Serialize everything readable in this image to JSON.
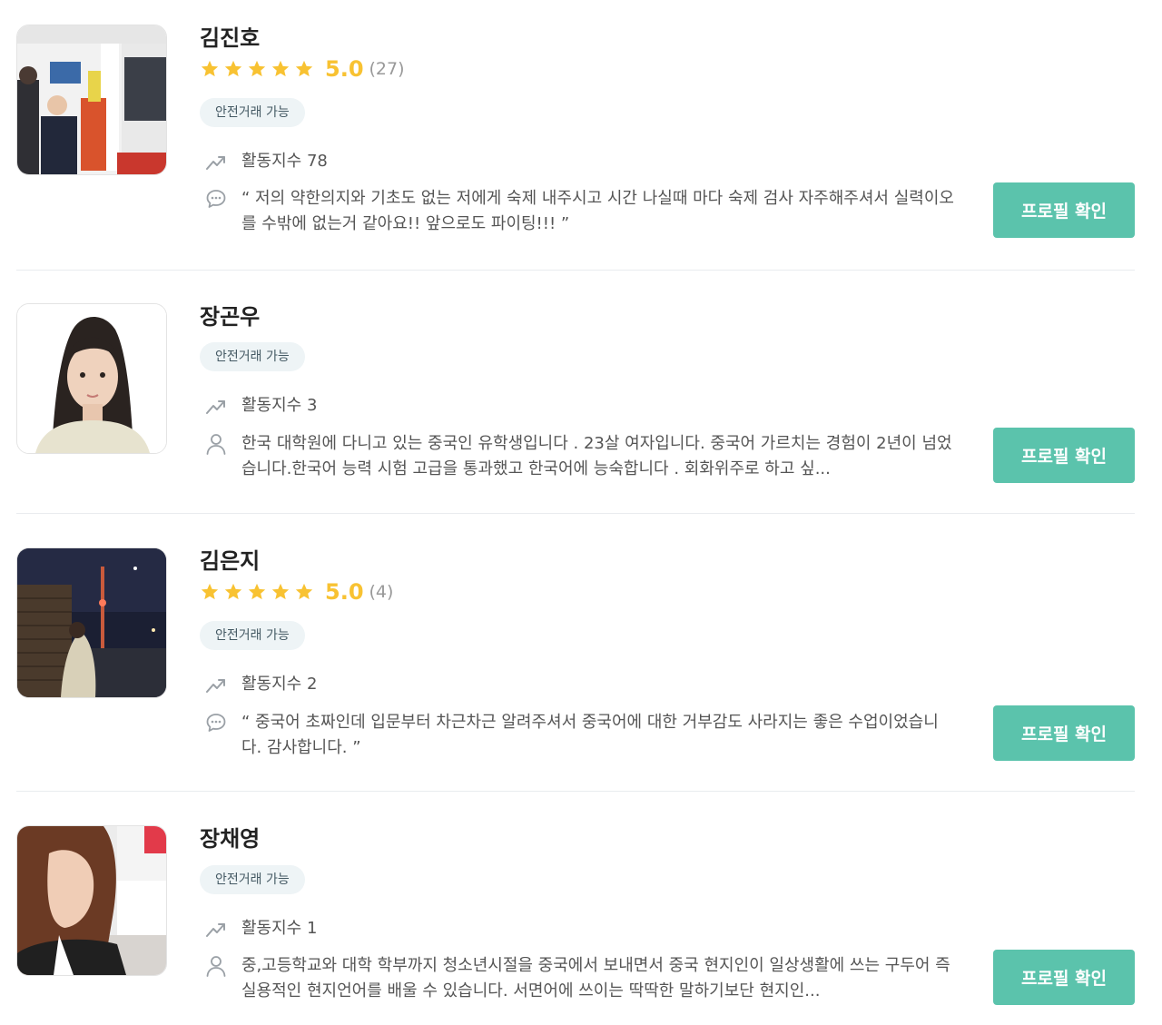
{
  "tutors": [
    {
      "name": "김진호",
      "has_rating": true,
      "rating": "5.0",
      "review_count": "(27)",
      "badge": "안전거래 가능",
      "activity": "활동지수 78",
      "desc_type": "review",
      "desc_icon": "speech-bubble-icon",
      "description": "“ 저의 약한의지와 기초도 없는 저에게 숙제 내주시고 시간 나실때 마다 숙제 검사 자주해주셔서 실력이오를 수밖에 없는거 같아요!! 앞으로도 파이팅!!! ”",
      "button": "프로필 확인"
    },
    {
      "name": "장곤우",
      "has_rating": false,
      "badge": "안전거래 가능",
      "activity": "활동지수 3",
      "desc_type": "intro",
      "desc_icon": "person-icon",
      "description": "한국 대학원에 다니고 있는 중국인 유학생입니다 . 23살 여자입니다. 중국어 가르치는 경험이 2년이 넘었습니다.한국어 능력 시험 고급을 통과했고 한국어에 능숙합니다 . 회화위주로 하고 싶...",
      "button": "프로필 확인"
    },
    {
      "name": "김은지",
      "has_rating": true,
      "rating": "5.0",
      "review_count": "(4)",
      "badge": "안전거래 가능",
      "activity": "활동지수 2",
      "desc_type": "review",
      "desc_icon": "speech-bubble-icon",
      "description": "“ 중국어 초짜인데 입문부터 차근차근 알려주셔서 중국어에 대한 거부감도 사라지는 좋은 수업이었습니다. 감사합니다. ”",
      "button": "프로필 확인"
    },
    {
      "name": "장채영",
      "has_rating": false,
      "badge": "안전거래 가능",
      "activity": "활동지수 1",
      "desc_type": "intro",
      "desc_icon": "person-icon",
      "description": "중,고등학교와 대학 학부까지 청소년시절을 중국에서 보내면서 중국 현지인이 일상생활에 쓰는 구두어 즉 실용적인 현지언어를 배울 수 있습니다. 서면어에 쓰이는 딱딱한 말하기보단 현지인...",
      "button": "프로필 확인"
    }
  ],
  "colors": {
    "accent": "#5bc3ac",
    "star": "#f8c232",
    "badge_bg": "#eef4f6",
    "badge_text": "#455a64"
  }
}
